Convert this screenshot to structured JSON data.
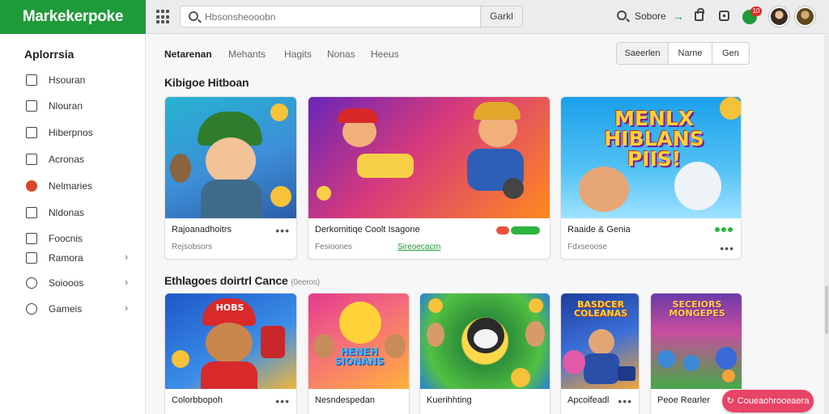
{
  "app": {
    "brand": "Markekerpoke"
  },
  "topbar": {
    "search_placeholder": "Hbsonsheooobn",
    "search_button": "Garkl",
    "label": "Sobore",
    "notification_count": "10"
  },
  "sidebar": {
    "title": "Aplorrsia",
    "items": [
      {
        "label": "Hsouran",
        "icon": "edit-icon",
        "chevron": false
      },
      {
        "label": "Nlouran",
        "icon": "camera-icon",
        "chevron": false
      },
      {
        "label": "Hiberpnos",
        "icon": "document-icon",
        "chevron": false
      },
      {
        "label": "Acronas",
        "icon": "share-icon",
        "chevron": false
      },
      {
        "label": "Nelmaries",
        "icon": "badge-icon",
        "chevron": false
      },
      {
        "label": "Nldonas",
        "icon": "chart-icon",
        "chevron": false
      },
      {
        "label": "Foocnis",
        "icon": "list-icon",
        "chevron": false
      },
      {
        "label": "Ramora",
        "icon": "bookmark-icon",
        "chevron": true
      },
      {
        "label": "Soiooos",
        "icon": "clock-icon",
        "chevron": true
      },
      {
        "label": "Gameis",
        "icon": "user-icon",
        "chevron": true
      }
    ]
  },
  "tabs": [
    "Netarenan",
    "Mehants",
    "Hagits",
    "Nonas",
    "Heeus"
  ],
  "sort": {
    "options": [
      "Saeerlen",
      "Narne",
      "Gen"
    ],
    "active": 0
  },
  "section1": {
    "title": "Kibigoe Hitboan",
    "cards": [
      {
        "title": "Rajoanadhoitrs",
        "subtitle": "Rejsobsors",
        "art_text": ""
      },
      {
        "title": "Derkomitiqe Coolt Isagone",
        "subtitle": "Fesioones",
        "link": "Sireoecacrn",
        "art_text": ""
      },
      {
        "title": "Raaide & Genia",
        "subtitle": "Fdxseoose",
        "art_text": "MENLX HIBLANS PIIS!"
      }
    ]
  },
  "section2": {
    "title": "Ethlagoes doirtrl Cance",
    "count": "(0eeros)",
    "cards": [
      {
        "title": "Colorbbopoh",
        "art_text": "HOBS"
      },
      {
        "title": "Nesndespedan",
        "art_text": "HENEH SIONANS"
      },
      {
        "title": "Kuerihhting",
        "art_text": ""
      },
      {
        "title": "Apcoifeadl",
        "art_text": "BASDCER COLEANAS"
      },
      {
        "title": "Peoe Rearler",
        "art_text": "SECEIORS MONGEPES"
      }
    ]
  },
  "promo": {
    "label": "Coueaohrooeaera"
  },
  "colors": {
    "brand": "#1f9a38",
    "promo": "#e74467",
    "badge": "#e02b2b"
  }
}
